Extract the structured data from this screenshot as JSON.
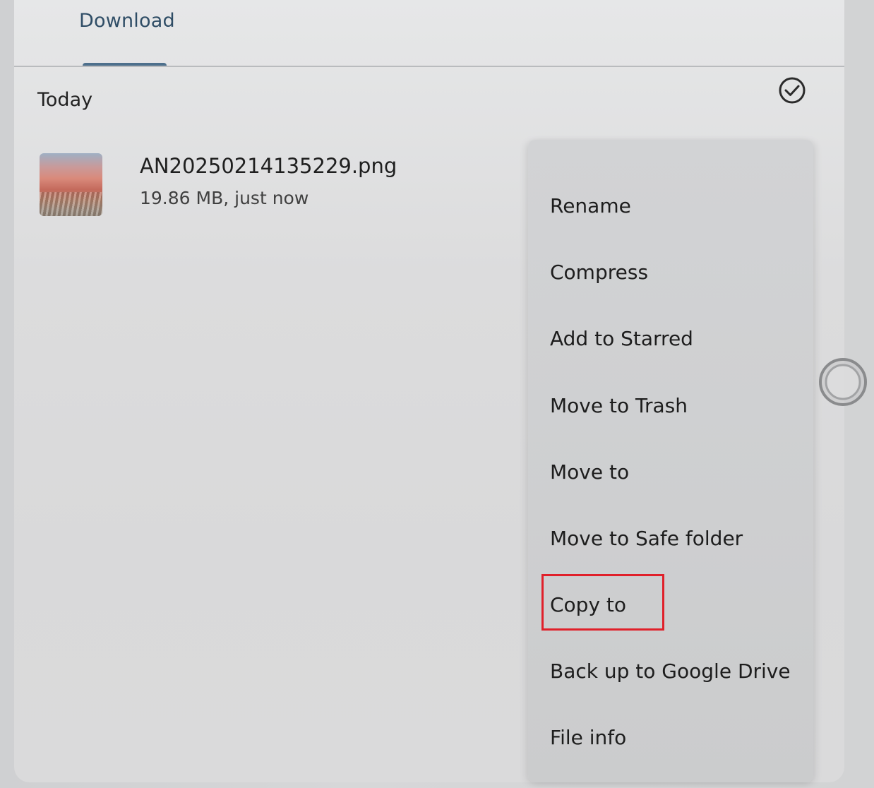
{
  "tabs": [
    {
      "label": "Download",
      "active": true
    }
  ],
  "section": {
    "title": "Today"
  },
  "icons": {
    "select_all": "check-circle-icon",
    "cursor": "touch-cursor-icon"
  },
  "file": {
    "name": "AN20250214135229.png",
    "meta": "19.86 MB, just now"
  },
  "menu": {
    "items": [
      {
        "label": "Rename"
      },
      {
        "label": "Compress"
      },
      {
        "label": "Add to Starred"
      },
      {
        "label": "Move to Trash"
      },
      {
        "label": "Move to"
      },
      {
        "label": "Move to Safe folder"
      },
      {
        "label": "Copy to",
        "highlighted": true
      },
      {
        "label": "Back up to Google Drive"
      },
      {
        "label": "File info"
      }
    ]
  },
  "colors": {
    "accent": "#4d6f8c",
    "tab_text": "#2f4d66",
    "highlight": "#e0202a"
  }
}
